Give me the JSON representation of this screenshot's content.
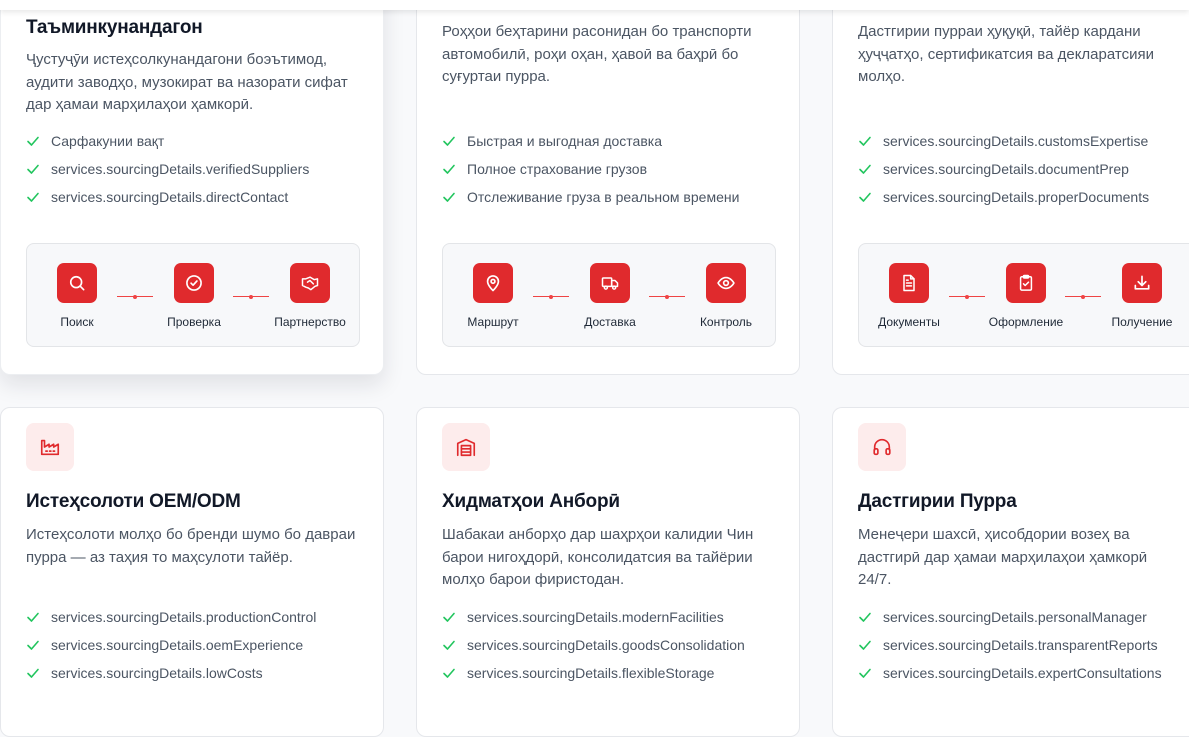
{
  "colors": {
    "accent": "#e02a2d",
    "check": "#22c55e",
    "icon_bg": "#fdecec"
  },
  "cards": [
    {
      "title": "Таъминкунандагон",
      "description": "Ҷустуҷӯи истеҳсолкунандагони боэътимод, аудити заводҳо, музокират ва назорати сифат дар ҳамаи марҳилаҳои ҳамкорӣ.",
      "features": [
        "Сарфакунии вақт",
        "services.sourcingDetails.verifiedSuppliers",
        "services.sourcingDetails.directContact"
      ],
      "steps": [
        {
          "label": "Поиск",
          "icon": "search-icon"
        },
        {
          "label": "Проверка",
          "icon": "check-circle-icon"
        },
        {
          "label": "Партнерство",
          "icon": "handshake-icon"
        }
      ]
    },
    {
      "title": "",
      "description": "Роҳҳои беҳтарини расонидан бо транспорти автомобилӣ, роҳи оҳан, ҳавоӣ ва баҳрӣ бо суғуртаи пурра.",
      "features": [
        "Быстрая и выгодная доставка",
        "Полное страхование грузов",
        "Отслеживание груза в реальном времени"
      ],
      "steps": [
        {
          "label": "Маршрут",
          "icon": "map-pin-icon"
        },
        {
          "label": "Доставка",
          "icon": "truck-icon"
        },
        {
          "label": "Контроль",
          "icon": "eye-icon"
        }
      ]
    },
    {
      "title": "",
      "description": "Дастгирии пурраи ҳуқуқӣ, тайёр кардани ҳуҷҷатҳо, сертификатсия ва декларатсияи молҳо.",
      "features": [
        "services.sourcingDetails.customsExpertise",
        "services.sourcingDetails.documentPrep",
        "services.sourcingDetails.properDocuments"
      ],
      "steps": [
        {
          "label": "Документы",
          "icon": "document-icon"
        },
        {
          "label": "Оформление",
          "icon": "clipboard-check-icon"
        },
        {
          "label": "Получение",
          "icon": "download-icon"
        }
      ]
    },
    {
      "title": "Истеҳсолоти OEM/ODM",
      "description": "Истеҳсолоти молҳо бо бренди шумо бо давраи пурра — аз таҳия то маҳсулоти тайёр.",
      "features": [
        "services.sourcingDetails.productionControl",
        "services.sourcingDetails.oemExperience",
        "services.sourcingDetails.lowCosts"
      ],
      "icon": "factory-icon"
    },
    {
      "title": "Хидматҳои Анборӣ",
      "description": "Шабакаи анборҳо дар шаҳрҳои калидии Чин барои нигоҳдорӣ, консолидатсия ва тайёрии молҳо барои фиристодан.",
      "features": [
        "services.sourcingDetails.modernFacilities",
        "services.sourcingDetails.goodsConsolidation",
        "services.sourcingDetails.flexibleStorage"
      ],
      "icon": "warehouse-icon"
    },
    {
      "title": "Дастгирии Пурра",
      "description": "Менеҷери шахсӣ, ҳисобдории возеҳ ва дастгирӣ дар ҳамаи марҳилаҳои ҳамкорӣ 24/7.",
      "features": [
        "services.sourcingDetails.personalManager",
        "services.sourcingDetails.transparentReports",
        "services.sourcingDetails.expertConsultations"
      ],
      "icon": "headphones-icon"
    }
  ]
}
